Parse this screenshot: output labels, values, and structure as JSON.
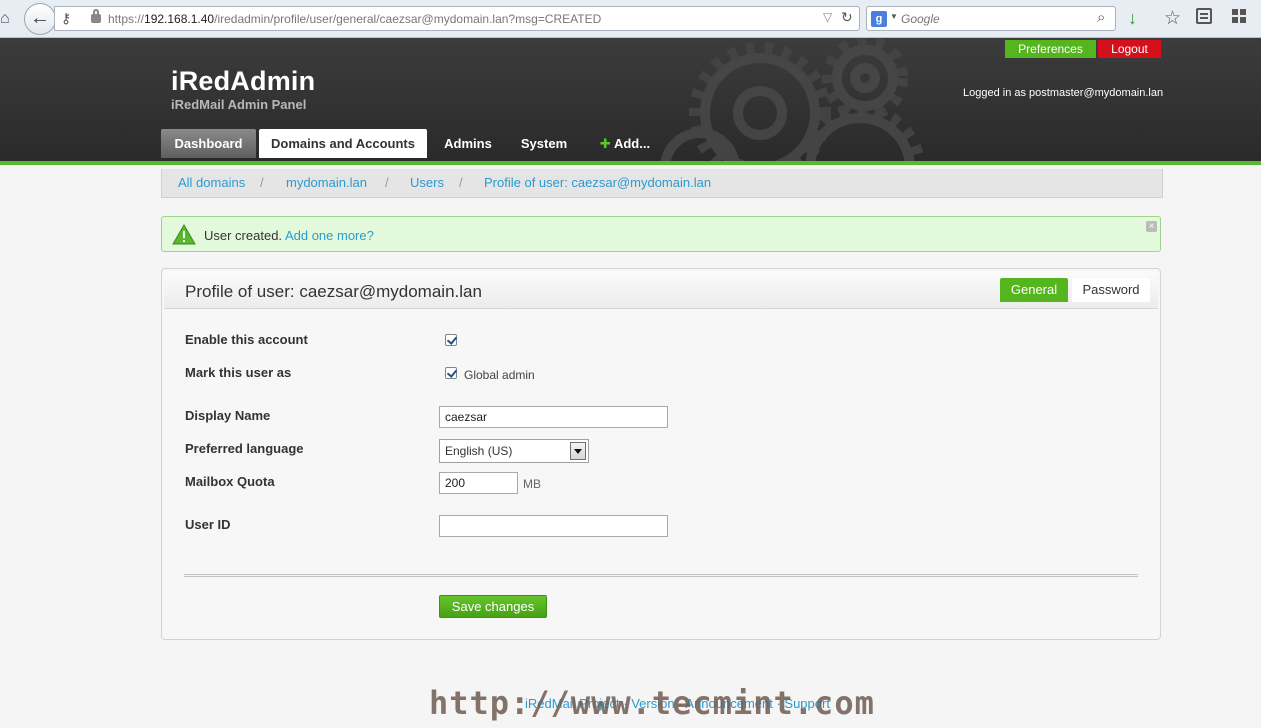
{
  "browser": {
    "url_prefix": "https://",
    "url_host": "192.168.1.40",
    "url_path": "/iredadmin/profile/user/general/caezsar@mydomain.lan?msg=CREATED",
    "search_placeholder": "Google"
  },
  "header": {
    "title": "iRedAdmin",
    "subtitle": "iRedMail Admin Panel",
    "preferences_label": "Preferences",
    "logout_label": "Logout",
    "logged_in_text": "Logged in as postmaster@mydomain.lan"
  },
  "nav": {
    "dashboard": "Dashboard",
    "domains": "Domains and Accounts",
    "admins": "Admins",
    "system": "System",
    "add": "Add..."
  },
  "breadcrumb": {
    "items": [
      "All domains",
      "mydomain.lan",
      "Users",
      "Profile of user: caezsar@mydomain.lan"
    ],
    "separator": "/"
  },
  "flash": {
    "message": "User created.",
    "link": "Add one more?"
  },
  "profile": {
    "title": "Profile of user: caezsar@mydomain.lan",
    "tabs": {
      "general": "General",
      "password": "Password"
    },
    "enable_label": "Enable this account",
    "enable_checked": true,
    "mark_label": "Mark this user as",
    "global_admin_label": "Global admin",
    "global_admin_checked": true,
    "display_name_label": "Display Name",
    "display_name_value": "caezsar",
    "language_label": "Preferred language",
    "language_value": "English (US)",
    "quota_label": "Mailbox Quota",
    "quota_value": "200",
    "quota_unit": "MB",
    "userid_label": "User ID",
    "userid_value": "",
    "save_label": "Save changes"
  },
  "footer": {
    "links_text": "iRedMail Project  ·  Version  ·  Announcement  ·  Support",
    "watermark": "http://www.tecmint.com"
  },
  "colors": {
    "accent_green": "#55b51f",
    "logout_red": "#d6101b",
    "link_blue": "#2a9bd0",
    "header_dark": "#2e2e2e"
  }
}
